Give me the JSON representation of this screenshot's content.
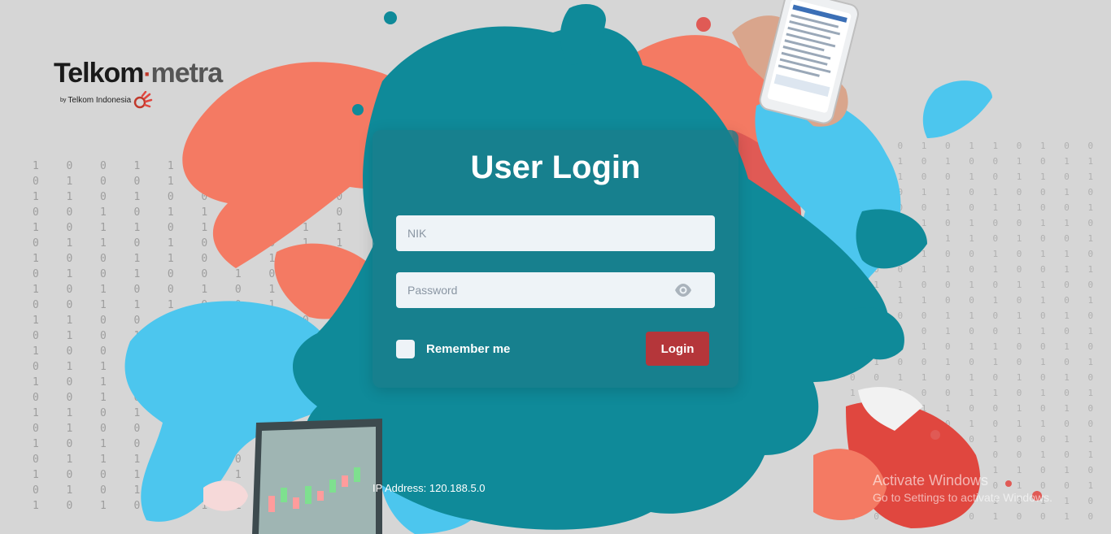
{
  "brand": {
    "name_part1": "Telkom",
    "name_part2": "metra",
    "by": "by",
    "parent": "Telkom Indonesia"
  },
  "background": {
    "digits_left": [
      "1  0  0  1  1  0  1  0  0  1",
      "0  1  0  0  1  0  1  1  0  0",
      "1  1  0  1  0  0  1  0  1  0",
      "0  0  1  0  1  1  0  1  0  0",
      "1  0  1  1  0  1  0  0  1  1",
      "0  1  1  0  1  0  1  0  1  1",
      "1  0  0  1  1  0  1  1  0  0",
      "0  1  0  1  0  0  1  0  0  1",
      "1  0  1  0  0  1  0  1  1  0",
      "0  0  1  1  1  0  0  1  0  1",
      "1  1  0  0  1  0  1  0  0  0",
      "0  1  0  1  1  1  0  0  1  0",
      "1  0  0  0  1  0  1  1  0  1",
      "0  1  1  0  0  1  0  1  0  0",
      "1  0  1  1  0  0  1  0  1  1",
      "0  0  1  0  1  1  0  1  0  1",
      "1  1  0  1  0  0  1  0  0  1",
      "0  1  0  0  1  0  1  1  1  0",
      "1  0  1  0  1  1  0  0  1  0",
      "0  1  1  1  0  1  0  1  0  0",
      "1  0  0  1  1  0  1  0  1  1",
      "0  1  0  1  0  1  0  0  1  0",
      "1  0  1  0  0  1  1  0  0  1"
    ],
    "digits_right": [
      "1 0 0 1 0 1 1 0 1 0 0 1 0 1 1 0",
      "0 1 1 0 1 0 0 1 0 1 1 0 1 0 0 1",
      "1 0 1 0 0 1 0 1 1 0 1 0 0 1 1 0",
      "0 1 0 1 1 0 1 0 0 1 0 1 1 0 0 1",
      "1 1 0 0 1 0 1 1 0 0 1 0 1 0 1 0",
      "0 0 1 1 0 1 0 0 1 1 0 1 0 1 0 1",
      "1 0 1 0 1 1 0 1 0 0 1 0 1 0 1 0",
      "0 1 0 1 0 0 1 0 1 1 0 1 0 1 0 1",
      "1 0 0 1 1 0 1 0 0 1 1 0 1 0 0 1",
      "0 1 1 0 0 1 0 1 1 0 0 1 0 1 1 0",
      "1 0 1 1 0 0 1 0 1 0 1 1 0 0 1 0",
      "0 1 0 0 1 1 0 1 0 1 0 0 1 1 0 1",
      "1 0 1 0 1 0 0 1 1 0 1 0 1 0 1 0",
      "0 1 0 1 0 1 1 0 0 1 0 1 0 1 0 1",
      "1 1 0 0 1 0 1 0 1 0 1 0 0 1 1 0",
      "0 0 1 1 0 1 0 1 0 1 0 1 1 0 0 1",
      "1 0 1 0 0 1 1 0 1 0 1 0 0 1 0 1",
      "0 1 0 1 1 0 0 1 0 1 0 1 1 0 1 0",
      "1 0 0 1 0 1 0 1 1 0 0 1 0 1 0 1",
      "0 1 1 0 1 0 1 0 0 1 1 0 1 0 1 0",
      "1 0 1 1 0 1 0 0 1 0 1 1 0 1 0 1",
      "0 1 0 0 1 0 1 1 0 1 0 0 1 0 1 0",
      "1 0 1 0 1 1 0 1 0 0 1 0 1 1 0 1",
      "0 1 0 1 0 0 1 0 1 1 0 1 0 0 1 0",
      "1 0 0 1 1 0 1 0 0 1 0 1 1 0 1 1"
    ]
  },
  "login": {
    "title": "User Login",
    "nik_placeholder": "NIK",
    "nik_value": "",
    "password_placeholder": "Password",
    "password_value": "",
    "remember_label": "Remember me",
    "remember_checked": false,
    "login_button": "Login"
  },
  "footer": {
    "ip_address": "IP Address: 120.188.5.0"
  },
  "watermark": {
    "title": "Activate Windows",
    "subtitle": "Go to Settings to activate Windows."
  },
  "colors": {
    "card": "#1a7d8a",
    "button": "#b5363a",
    "teal_splash": "#0f8a99",
    "coral_splash": "#f47a63",
    "blue_splash": "#4cc6ee"
  },
  "icons": {
    "password_toggle": "eye-icon",
    "brand_mark": "telkom-logo-icon"
  }
}
